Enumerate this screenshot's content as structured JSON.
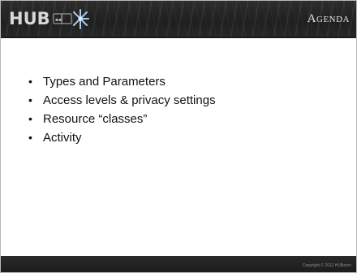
{
  "header": {
    "logo_text": "HUB",
    "logo_mark_icon": "hubzero-spark-icon",
    "title": "Agenda"
  },
  "agenda": {
    "items": [
      {
        "label": "Types and Parameters"
      },
      {
        "label": "Access levels & privacy settings"
      },
      {
        "label": "Resource “classes”"
      },
      {
        "label": "Activity"
      }
    ],
    "bullet_glyph": "•"
  },
  "footer": {
    "copyright": "Copyright © 2011 HUBzero"
  },
  "colors": {
    "header_background": "#222222",
    "title_text": "#e6e6e6",
    "body_text": "#111111",
    "logo_text": "#d8d8d8",
    "logo_accent": "#a9c8ea"
  }
}
